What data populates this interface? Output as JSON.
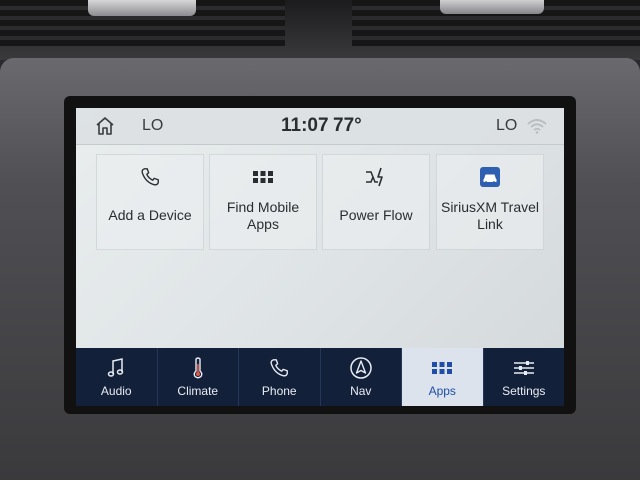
{
  "status": {
    "lo_left": "LO",
    "clock": "11:07",
    "temp": "77°",
    "lo_right": "LO"
  },
  "apps": [
    {
      "label": "Add a Device",
      "icon": "phone-icon"
    },
    {
      "label": "Find Mobile Apps",
      "icon": "grid-icon"
    },
    {
      "label": "Power Flow",
      "icon": "power-flow-icon"
    },
    {
      "label": "SiriusXM Travel Link",
      "icon": "car-icon"
    }
  ],
  "nav": [
    {
      "label": "Audio",
      "icon": "music-note-icon"
    },
    {
      "label": "Climate",
      "icon": "thermometer-icon"
    },
    {
      "label": "Phone",
      "icon": "phone-icon"
    },
    {
      "label": "Nav",
      "icon": "navigation-arrow-icon"
    },
    {
      "label": "Apps",
      "icon": "grid-icon",
      "active": true
    },
    {
      "label": "Settings",
      "icon": "sliders-icon"
    }
  ],
  "colors": {
    "navbar": "#13203a",
    "active_tab_bg": "#dde3ec",
    "active_tab_text": "#1e4ea6"
  }
}
